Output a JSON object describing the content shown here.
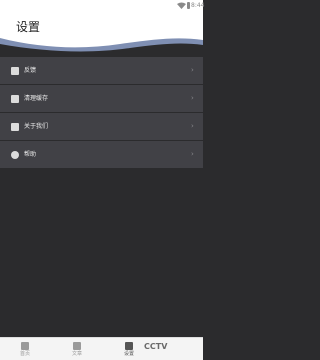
{
  "status_bar": {
    "time": "8:44"
  },
  "header": {
    "title": "设置"
  },
  "menu": {
    "items": [
      {
        "label": "反馈",
        "icon": "feedback-icon"
      },
      {
        "label": "清理缓存",
        "icon": "trash-icon"
      },
      {
        "label": "关于我们",
        "icon": "info-icon"
      },
      {
        "label": "帮助",
        "icon": "help-icon"
      }
    ],
    "chevron": "›"
  },
  "tabs": [
    {
      "label": "首页",
      "icon": "home-icon"
    },
    {
      "label": "文章",
      "icon": "article-icon"
    },
    {
      "label": "设置",
      "icon": "settings-icon"
    }
  ],
  "watermark": "CCTV"
}
